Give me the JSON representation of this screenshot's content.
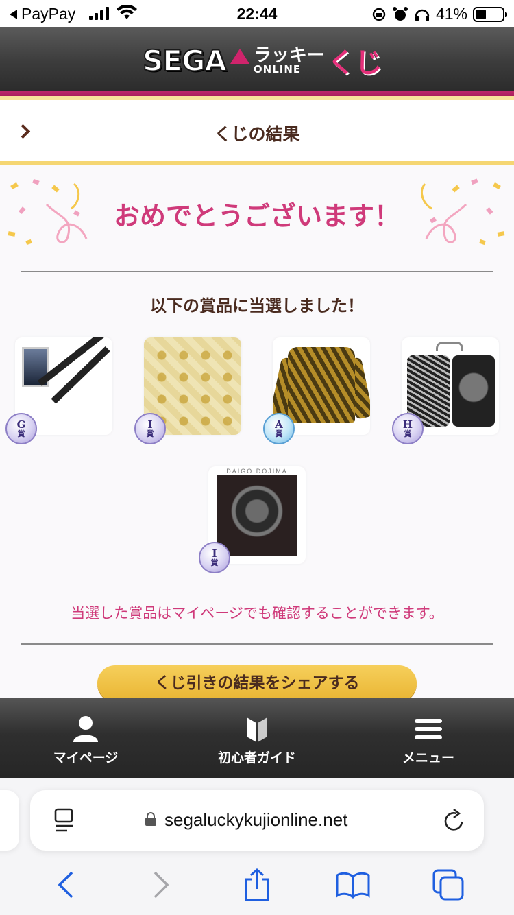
{
  "status_bar": {
    "back_app": "PayPay",
    "time": "22:44",
    "battery": "41%"
  },
  "header": {
    "logo_sega": "SEGA",
    "logo_lucky": "ラッキー",
    "logo_online": "ONLINE",
    "logo_kuji": "くじ"
  },
  "page": {
    "title": "くじの結果",
    "congrats": "おめでとうございます！",
    "won_heading": "以下の賞品に当選しました！",
    "note": "当選した賞品はマイページでも確認することができます。",
    "share_button": "くじ引きの結果をシェアする"
  },
  "prizes": [
    {
      "grade": "G",
      "label": "賞",
      "item": "lanyard"
    },
    {
      "grade": "I",
      "label": "賞",
      "item": "handkerchief"
    },
    {
      "grade": "A",
      "label": "賞",
      "item": "shirt"
    },
    {
      "grade": "H",
      "label": "賞",
      "item": "card-cases"
    },
    {
      "grade": "I",
      "label": "賞",
      "item": "art-panel",
      "caption": "DAIGO DOJIMA"
    }
  ],
  "app_nav": {
    "mypage": "マイページ",
    "guide": "初心者ガイド",
    "menu": "メニュー"
  },
  "browser": {
    "url": "segaluckykujionline.net"
  },
  "colors": {
    "accent_pink": "#cf3a7a",
    "brown_text": "#4a2b1f",
    "share_yellow": "#f0c044",
    "ios_blue": "#1f5fe0"
  }
}
